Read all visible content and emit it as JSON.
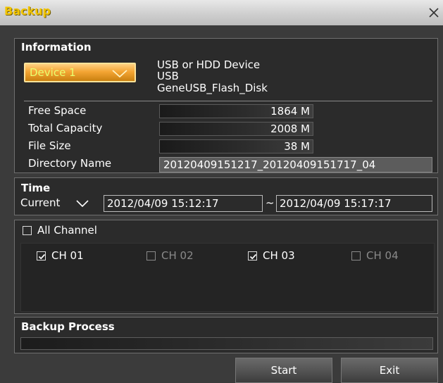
{
  "window": {
    "title": "Backup"
  },
  "information": {
    "section_title": "Information",
    "device_select": "Device 1",
    "device_lines": [
      "USB or HDD Device",
      "USB",
      "GeneUSB_Flash_Disk"
    ],
    "free_space_label": "Free Space",
    "free_space": "1864 M",
    "total_capacity_label": "Total Capacity",
    "total_capacity": "2008 M",
    "file_size_label": "File Size",
    "file_size": "38 M",
    "directory_name_label": "Directory Name",
    "directory_name": "20120409151217_20120409151717_04"
  },
  "time": {
    "section_title": "Time",
    "mode": "Current",
    "start": "2012/04/09  15:12:17",
    "separator": "~",
    "end": "2012/04/09  15:17:17"
  },
  "channels": {
    "all_label": "All Channel",
    "all_checked": false,
    "items": [
      {
        "label": "CH 01",
        "checked": true,
        "enabled": true
      },
      {
        "label": "CH 02",
        "checked": false,
        "enabled": false
      },
      {
        "label": "CH 03",
        "checked": true,
        "enabled": true
      },
      {
        "label": "CH 04",
        "checked": false,
        "enabled": false
      }
    ]
  },
  "process": {
    "section_title": "Backup Process",
    "progress": 0
  },
  "buttons": {
    "start": "Start",
    "exit": "Exit"
  }
}
